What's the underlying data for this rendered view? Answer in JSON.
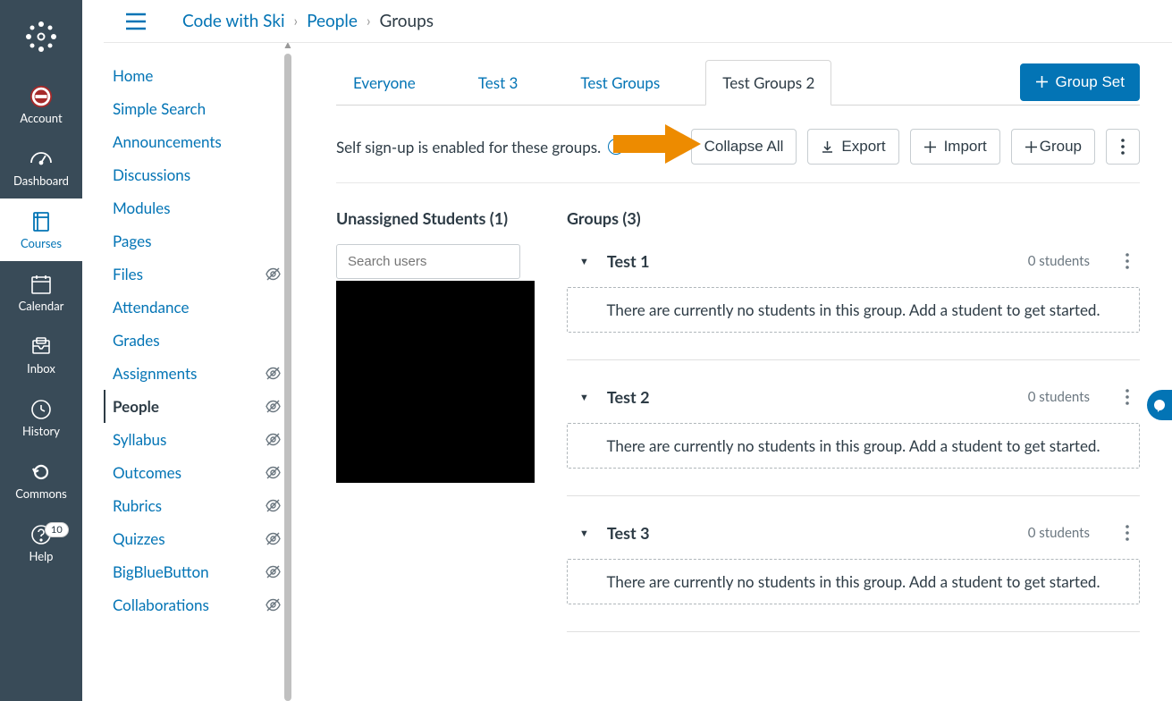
{
  "globalNav": {
    "items": [
      {
        "label": "Account"
      },
      {
        "label": "Dashboard"
      },
      {
        "label": "Courses"
      },
      {
        "label": "Calendar"
      },
      {
        "label": "Inbox"
      },
      {
        "label": "History"
      },
      {
        "label": "Commons"
      },
      {
        "label": "Help",
        "badge": "10"
      }
    ]
  },
  "breadcrumb": {
    "course": "Code with Ski",
    "parent": "People",
    "current": "Groups"
  },
  "courseNav": {
    "items": [
      {
        "label": "Home",
        "hidden": false
      },
      {
        "label": "Simple Search",
        "hidden": false
      },
      {
        "label": "Announcements",
        "hidden": false
      },
      {
        "label": "Discussions",
        "hidden": false
      },
      {
        "label": "Modules",
        "hidden": false
      },
      {
        "label": "Pages",
        "hidden": false
      },
      {
        "label": "Files",
        "hidden": true
      },
      {
        "label": "Attendance",
        "hidden": false
      },
      {
        "label": "Grades",
        "hidden": false
      },
      {
        "label": "Assignments",
        "hidden": true
      },
      {
        "label": "People",
        "hidden": true,
        "active": true
      },
      {
        "label": "Syllabus",
        "hidden": true
      },
      {
        "label": "Outcomes",
        "hidden": true
      },
      {
        "label": "Rubrics",
        "hidden": true
      },
      {
        "label": "Quizzes",
        "hidden": true
      },
      {
        "label": "BigBlueButton",
        "hidden": true
      },
      {
        "label": "Collaborations",
        "hidden": true
      }
    ]
  },
  "tabs": {
    "items": [
      {
        "label": "Everyone"
      },
      {
        "label": "Test 3"
      },
      {
        "label": "Test Groups"
      },
      {
        "label": "Test Groups 2",
        "active": true
      }
    ],
    "groupSetBtn": "Group Set"
  },
  "signup": {
    "msg": "Self sign-up is enabled for these groups.",
    "collapse": "Collapse All",
    "export": "Export",
    "import": "Import",
    "group": "Group"
  },
  "unassigned": {
    "title": "Unassigned Students (1)",
    "search_placeholder": "Search users"
  },
  "groupsHeader": "Groups (3)",
  "groups": [
    {
      "name": "Test 1",
      "count": "0 students",
      "empty": "There are currently no students in this group. Add a student to get started."
    },
    {
      "name": "Test 2",
      "count": "0 students",
      "empty": "There are currently no students in this group. Add a student to get started."
    },
    {
      "name": "Test 3",
      "count": "0 students",
      "empty": "There are currently no students in this group. Add a student to get started."
    }
  ]
}
